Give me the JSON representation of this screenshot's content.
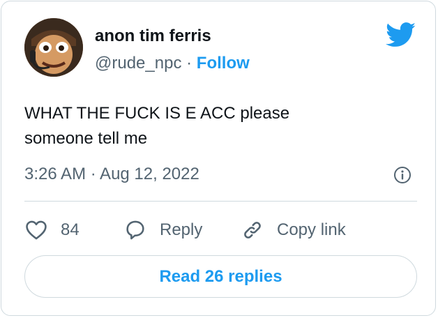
{
  "colors": {
    "accent": "#1d9bf0",
    "text": "#0f1419",
    "secondary": "#536471",
    "border": "#cfd9de"
  },
  "author": {
    "name": "anon tim ferris",
    "handle": "@rude_npc",
    "separator": "·",
    "follow_label": "Follow"
  },
  "tweet": {
    "text_line1": "WHAT THE FUCK IS E ACC please",
    "text_line2": "someone tell me",
    "timestamp": "3:26 AM · Aug 12, 2022"
  },
  "actions": {
    "like_count": "84",
    "reply_label": "Reply",
    "copy_link_label": "Copy link"
  },
  "footer": {
    "read_replies_label": "Read 26 replies"
  },
  "icons": [
    "twitter-bird-icon",
    "info-icon",
    "heart-icon",
    "reply-icon",
    "link-icon"
  ]
}
